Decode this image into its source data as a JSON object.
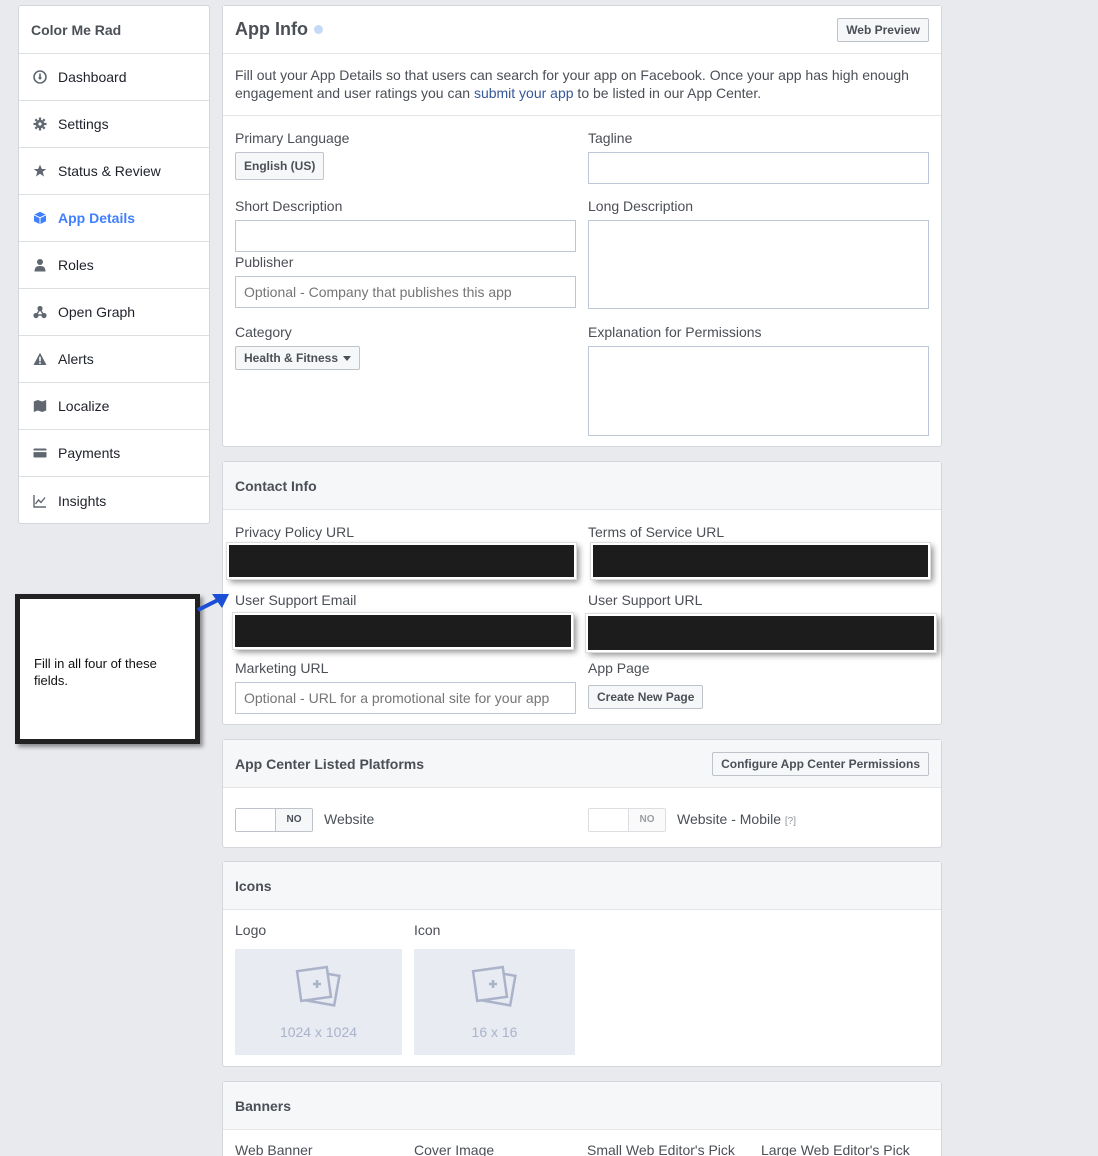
{
  "sidebar": {
    "title": "Color Me Rad",
    "items": [
      {
        "label": "Dashboard",
        "icon": "dashboard-icon"
      },
      {
        "label": "Settings",
        "icon": "gear-icon"
      },
      {
        "label": "Status & Review",
        "icon": "star-icon"
      },
      {
        "label": "App Details",
        "icon": "cube-icon",
        "active": true
      },
      {
        "label": "Roles",
        "icon": "person-icon"
      },
      {
        "label": "Open Graph",
        "icon": "graph-icon"
      },
      {
        "label": "Alerts",
        "icon": "warning-icon"
      },
      {
        "label": "Localize",
        "icon": "map-icon"
      },
      {
        "label": "Payments",
        "icon": "card-icon"
      },
      {
        "label": "Insights",
        "icon": "chart-icon"
      }
    ]
  },
  "app_info": {
    "title": "App Info",
    "web_preview": "Web Preview",
    "description_pre": "Fill out your App Details so that users can search for your app on Facebook. Once your app has high enough engagement and user ratings you can ",
    "description_link": "submit your app",
    "description_post": " to be listed in our App Center.",
    "primary_language_label": "Primary Language",
    "primary_language_value": "English (US)",
    "tagline_label": "Tagline",
    "short_description_label": "Short Description",
    "long_description_label": "Long Description",
    "publisher_label": "Publisher",
    "publisher_placeholder": "Optional - Company that publishes this app",
    "category_label": "Category",
    "category_value": "Health & Fitness",
    "permissions_label": "Explanation for Permissions"
  },
  "contact_info": {
    "title": "Contact Info",
    "privacy_label": "Privacy Policy URL",
    "tos_label": "Terms of Service URL",
    "support_email_label": "User Support Email",
    "support_url_label": "User Support URL",
    "marketing_label": "Marketing URL",
    "marketing_placeholder": "Optional - URL for a promotional site for your app",
    "app_page_label": "App Page",
    "create_page_button": "Create New Page"
  },
  "platforms": {
    "title": "App Center Listed Platforms",
    "configure_button": "Configure App Center Permissions",
    "website_toggle": "NO",
    "website_label": "Website",
    "mobile_toggle": "NO",
    "mobile_label": "Website - Mobile",
    "mobile_help": "[?]"
  },
  "icons": {
    "title": "Icons",
    "logo_label": "Logo",
    "logo_dim": "1024 x 1024",
    "icon_label": "Icon",
    "icon_dim": "16 x 16"
  },
  "banners": {
    "title": "Banners",
    "labels": [
      "Web Banner",
      "Cover Image",
      "Small Web Editor's Pick",
      "Large Web Editor's Pick"
    ]
  },
  "callout": {
    "text": "Fill in all four of these fields."
  },
  "colors": {
    "accent": "#4080ff",
    "link": "#365899",
    "arrow": "#1a4fd6"
  }
}
